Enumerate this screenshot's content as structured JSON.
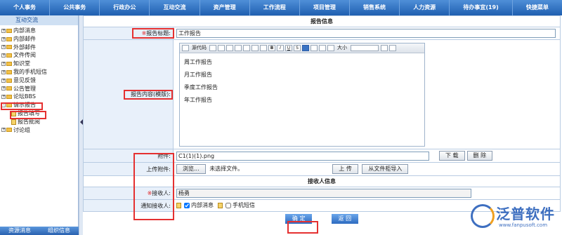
{
  "nav": [
    "个人事务",
    "公共事务",
    "行政办公",
    "互动交流",
    "资产管理",
    "工作流程",
    "项目管理",
    "销售系统",
    "人力资源",
    "待办事宜(19)",
    "快捷菜单"
  ],
  "sidebar": {
    "header": "互动交流",
    "items": [
      {
        "label": "内部消息",
        "exp": "+"
      },
      {
        "label": "内部邮件",
        "exp": "+"
      },
      {
        "label": "外部邮件",
        "exp": "+"
      },
      {
        "label": "文件传阅",
        "exp": "+"
      },
      {
        "label": "知识堂",
        "exp": "+"
      },
      {
        "label": "我的手机短信",
        "exp": "+"
      },
      {
        "label": "意见反馈",
        "exp": "+"
      },
      {
        "label": "公告管理",
        "exp": "+"
      },
      {
        "label": "论坛BBS",
        "exp": "+"
      },
      {
        "label": "请示报告",
        "exp": "-"
      },
      {
        "label": "报告填写",
        "child": true
      },
      {
        "label": "报告批阅",
        "child": true
      },
      {
        "label": "讨论组",
        "exp": "+"
      }
    ],
    "footer": [
      "资源消息",
      "组织信息"
    ]
  },
  "form": {
    "section_title": "报告信息",
    "title_label": "报告标题:",
    "title_value": "工作报告",
    "content_label": "报告内容(模版):",
    "editor_toolbar": {
      "source": "源代码",
      "font_size": "大小"
    },
    "editor_lines": [
      "周工作报告",
      "月工作报告",
      "季度工作报告",
      "年工作报告"
    ],
    "attach_label": "附件:",
    "attach_value": "C1(1)(1).png",
    "download_btn": "下 载",
    "delete_btn": "删 除",
    "upload_label": "上传附件:",
    "browse_btn": "浏览...",
    "no_file": "未选择文件。",
    "upload_btn": "上 传",
    "import_btn": "从文件柜导入",
    "receiver_section": "接收人信息",
    "receiver_label": "接收人:",
    "receiver_value": "杨勇",
    "notify_label": "通知接收人:",
    "notify_internal": "内部消息",
    "notify_sms": "手机短信",
    "ok_btn": "确 定",
    "back_btn": "返 回"
  },
  "watermark": {
    "text": "泛普软件",
    "url": "www.fanpusoft.com"
  },
  "colors": {
    "nav": "#2a6cc0",
    "highlight": "#e53030",
    "label_bg": "#e8f0fa"
  }
}
